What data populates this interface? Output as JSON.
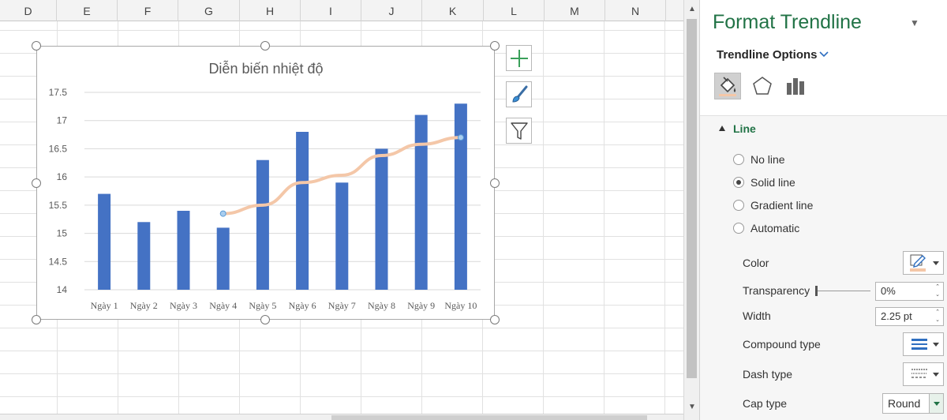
{
  "sheet": {
    "columns": [
      "D",
      "E",
      "F",
      "G",
      "H",
      "I",
      "J",
      "K",
      "L",
      "M",
      "N"
    ]
  },
  "chart_data": {
    "type": "bar",
    "title": "Diễn biến nhiệt độ",
    "categories": [
      "Ngày 1",
      "Ngày 2",
      "Ngày 3",
      "Ngày 4",
      "Ngày 5",
      "Ngày 6",
      "Ngày 7",
      "Ngày 8",
      "Ngày 9",
      "Ngày 10"
    ],
    "values": [
      15.7,
      15.2,
      15.4,
      15.1,
      16.3,
      16.8,
      15.9,
      16.5,
      17.1,
      17.3
    ],
    "ylim": [
      14,
      17.5
    ],
    "yticks": [
      "14",
      "14.5",
      "15",
      "15.5",
      "16",
      "16.5",
      "17",
      "17.5"
    ],
    "bar_color": "#4472c4",
    "grid": true,
    "trendline": {
      "type": "moving average",
      "color": "#f4c7a8",
      "x_categories": [
        "Ngày 4",
        "Ngày 5",
        "Ngày 6",
        "Ngày 7",
        "Ngày 8",
        "Ngày 9",
        "Ngày 10"
      ],
      "values": [
        15.35,
        15.5,
        15.9,
        16.03,
        16.38,
        16.58,
        16.7
      ]
    }
  },
  "chart_buttons": {
    "elements": "plus-icon",
    "styles": "paintbrush-icon",
    "filters": "filter-icon"
  },
  "pane": {
    "title": "Format Trendline",
    "section": "Trendline Options",
    "line_header": "Line",
    "radios": [
      {
        "label": "No line",
        "selected": false
      },
      {
        "label": "Solid line",
        "selected": true
      },
      {
        "label": "Gradient line",
        "selected": false
      },
      {
        "label": "Automatic",
        "selected": false
      }
    ],
    "props": {
      "color": "Color",
      "transparency": "Transparency",
      "transparency_value": "0%",
      "width": "Width",
      "width_value": "2.25 pt",
      "compound": "Compound type",
      "dash": "Dash type",
      "cap": "Cap type",
      "cap_value": "Round"
    },
    "accent_color": "#217346"
  }
}
